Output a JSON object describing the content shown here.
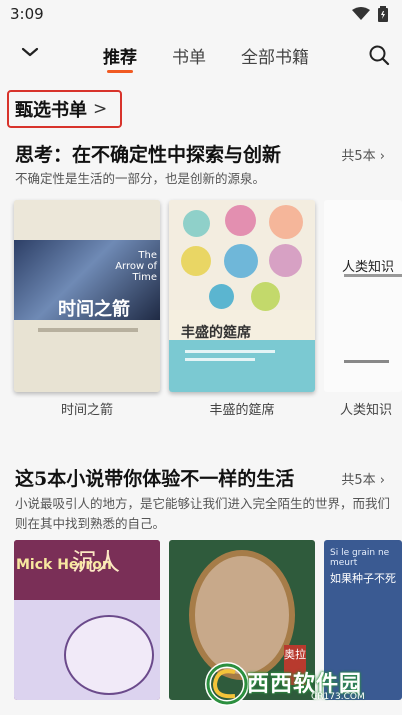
{
  "status": {
    "time": "3:09"
  },
  "nav": {
    "tabs": [
      {
        "label": "推荐",
        "active": true
      },
      {
        "label": "书单",
        "active": false
      },
      {
        "label": "全部书籍",
        "active": false
      }
    ]
  },
  "featured": {
    "title": "甄选书单",
    "chevron": ">"
  },
  "sections": [
    {
      "title": "思考：在不确定性中探索与创新",
      "count": "共5本",
      "description": "不确定性是生活的一部分，也是创新的源泉。",
      "books": [
        {
          "title": "时间之箭",
          "cover_en": "The Arrow of Time",
          "cover_cn": "时间之箭"
        },
        {
          "title": "丰盛的筵席",
          "cover_cn": "丰盛的筵席"
        },
        {
          "title": "人类知识",
          "cover_cn": "人类知识"
        }
      ]
    },
    {
      "title": "这5本小说带你体验不一样的生活",
      "count": "共5本",
      "description": "小说最吸引人的地方，是它能够让我们进入完全陌生的世界，而我们则在其中找到熟悉的自己。",
      "books": [
        {
          "cover_en": "Mick Herron",
          "cover_cn": "沉人"
        },
        {
          "cover_cn": "奥拉"
        },
        {
          "cover_en": "Si le grain ne meurt",
          "cover_cn": "如果种子不死"
        }
      ]
    }
  ],
  "watermark": {
    "text": "西西软件园",
    "url": "CR173.COM"
  },
  "colors": {
    "accent": "#f15a22",
    "highlight_box": "#d8332b",
    "background": "#f6f6f6"
  }
}
